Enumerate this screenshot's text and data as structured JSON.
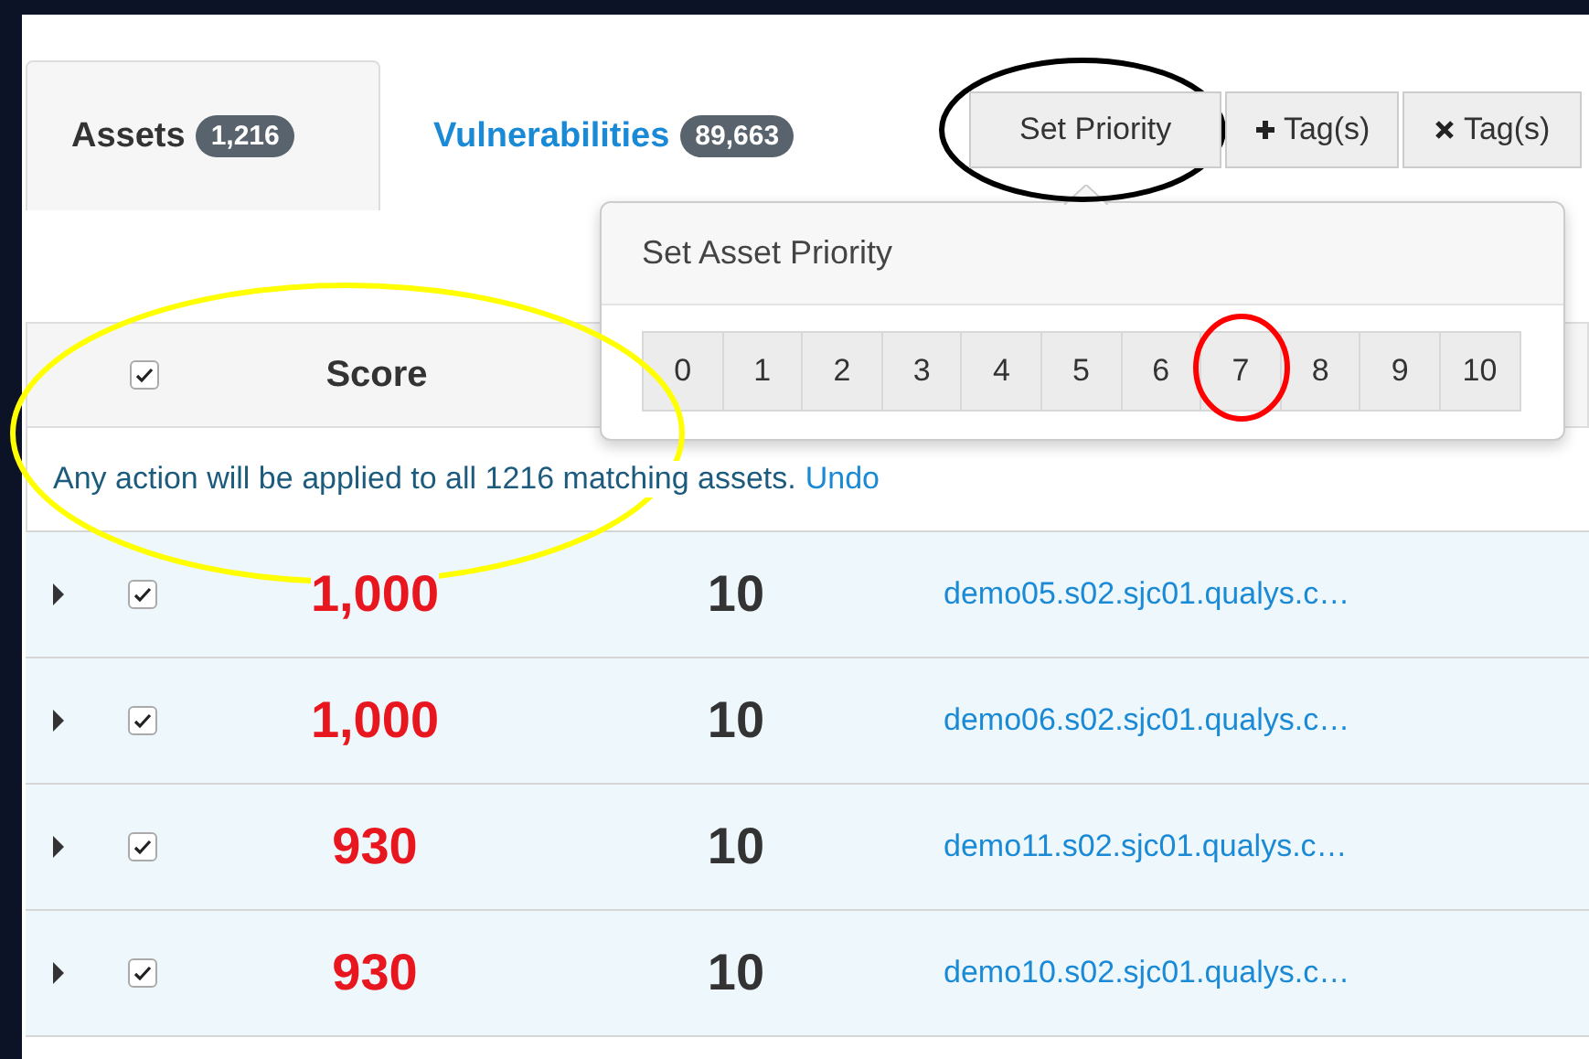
{
  "tabs": [
    {
      "label": "Assets",
      "count": "1,216",
      "selected": true
    },
    {
      "label": "Vulnerabilities",
      "count": "89,663",
      "selected": false
    }
  ],
  "toolbar": [
    {
      "kind": "plain",
      "label": "Set Priority"
    },
    {
      "kind": "add",
      "label": "Tag(s)"
    },
    {
      "kind": "remove",
      "label": "Tag(s)"
    }
  ],
  "popover": {
    "title": "Set Asset Priority",
    "options": [
      "0",
      "1",
      "2",
      "3",
      "4",
      "5",
      "6",
      "7",
      "8",
      "9",
      "10"
    ]
  },
  "table": {
    "select_all_checked": true,
    "columns": [
      "Score"
    ],
    "notice": "Any action will be applied to all 1216 matching assets.",
    "notice_link": "Undo",
    "rows": [
      {
        "expanded": false,
        "checked": true,
        "score": "1,000",
        "column_3": "10",
        "host": "demo05.s02.sjc01.qualys.c…"
      },
      {
        "expanded": false,
        "checked": true,
        "score": "1,000",
        "column_3": "10",
        "host": "demo06.s02.sjc01.qualys.c…"
      },
      {
        "expanded": false,
        "checked": true,
        "score": "930",
        "column_3": "10",
        "host": "demo11.s02.sjc01.qualys.c…"
      },
      {
        "expanded": false,
        "checked": true,
        "score": "930",
        "column_3": "10",
        "host": "demo10.s02.sjc01.qualys.c…"
      }
    ]
  }
}
